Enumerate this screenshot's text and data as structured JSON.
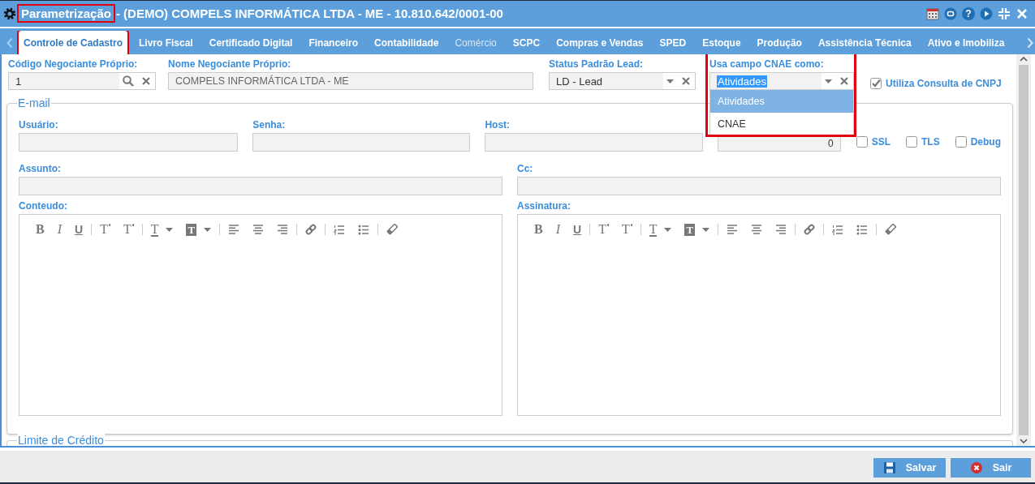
{
  "window": {
    "title": "Parametrização",
    "title_highlighted": true,
    "subtitle": "- (DEMO) COMPELS INFORMÁTICA LTDA - ME - 10.810.642/0001-00",
    "buttons": [
      {
        "kind": "calendar"
      },
      {
        "kind": "chat"
      },
      {
        "kind": "help",
        "glyph": "?"
      },
      {
        "kind": "play"
      },
      {
        "kind": "restore"
      },
      {
        "kind": "close"
      }
    ]
  },
  "tabs": [
    {
      "label": "Controle de Cadastro",
      "selected": true,
      "highlighted": true,
      "disabled": false
    },
    {
      "label": "Livro Fiscal",
      "selected": false,
      "highlighted": false,
      "disabled": false
    },
    {
      "label": "Certificado Digital",
      "selected": false,
      "highlighted": false,
      "disabled": false
    },
    {
      "label": "Financeiro",
      "selected": false,
      "highlighted": false,
      "disabled": false
    },
    {
      "label": "Contabilidade",
      "selected": false,
      "highlighted": false,
      "disabled": false
    },
    {
      "label": "Comércio",
      "selected": false,
      "highlighted": false,
      "disabled": true
    },
    {
      "label": "SCPC",
      "selected": false,
      "highlighted": false,
      "disabled": false
    },
    {
      "label": "Compras e Vendas",
      "selected": false,
      "highlighted": false,
      "disabled": false
    },
    {
      "label": "SPED",
      "selected": false,
      "highlighted": false,
      "disabled": false
    },
    {
      "label": "Estoque",
      "selected": false,
      "highlighted": false,
      "disabled": false
    },
    {
      "label": "Produção",
      "selected": false,
      "highlighted": false,
      "disabled": false
    },
    {
      "label": "Assistência Técnica",
      "selected": false,
      "highlighted": false,
      "disabled": false
    },
    {
      "label": "Ativo e Imobiliza",
      "selected": false,
      "highlighted": false,
      "disabled": false
    }
  ],
  "fields": [
    {
      "kind": "lookup",
      "label": "Código Negociante Próprio:",
      "value": "1"
    },
    {
      "kind": "text",
      "label": "Nome Negociante Próprio:",
      "value": "COMPELS INFORMÁTICA LTDA - ME"
    },
    {
      "kind": "select",
      "label": "Status Padrão Lead:",
      "value": "LD - Lead",
      "expanded": false,
      "highlighted": false
    },
    {
      "kind": "select",
      "label": "Usa campo CNAE como:",
      "value": "Atividades",
      "expanded": true,
      "highlighted": true,
      "options": [
        {
          "label": "Atividades",
          "selected": true
        },
        {
          "label": "CNAE",
          "selected": false
        }
      ]
    },
    {
      "kind": "checkbox",
      "label": "Utiliza Consulta de CNPJ",
      "checked": true
    }
  ],
  "email": {
    "legend": "E-mail",
    "row_1": [
      {
        "kind": "text",
        "label": "Usuário:"
      },
      {
        "kind": "text",
        "label": "Senha:"
      },
      {
        "kind": "text",
        "label": "Host:"
      },
      {
        "kind": "number",
        "value": "0"
      },
      {
        "kind": "checkbox",
        "label": "SSL",
        "checked": false
      },
      {
        "kind": "checkbox",
        "label": "TLS",
        "checked": false
      },
      {
        "kind": "checkbox",
        "label": "Debug",
        "checked": false
      }
    ],
    "row_2": [
      {
        "kind": "text",
        "label": "Assunto:"
      },
      {
        "kind": "text",
        "label": "Cc:"
      }
    ],
    "editors": [
      {
        "label": "Conteudo:",
        "toolbar": [
          {
            "kind": "bold",
            "glyph": "B"
          },
          {
            "kind": "italic",
            "glyph": "I"
          },
          {
            "kind": "underline",
            "glyph": "U"
          },
          {
            "kind": "separator"
          },
          {
            "kind": "superscript",
            "glyph": "T"
          },
          {
            "kind": "subscript",
            "glyph": "T"
          },
          {
            "kind": "separator"
          },
          {
            "kind": "text-color",
            "glyph": "T"
          },
          {
            "kind": "highlight",
            "glyph": "T"
          },
          {
            "kind": "separator"
          },
          {
            "kind": "align-left"
          },
          {
            "kind": "align-center"
          },
          {
            "kind": "align-right"
          },
          {
            "kind": "separator"
          },
          {
            "kind": "link"
          },
          {
            "kind": "separator"
          },
          {
            "kind": "ordered-list"
          },
          {
            "kind": "bullet-list"
          },
          {
            "kind": "separator"
          },
          {
            "kind": "eraser"
          }
        ]
      },
      {
        "label": "Assinatura:",
        "toolbar": [
          {
            "kind": "bold",
            "glyph": "B"
          },
          {
            "kind": "italic",
            "glyph": "I"
          },
          {
            "kind": "underline",
            "glyph": "U"
          },
          {
            "kind": "separator"
          },
          {
            "kind": "superscript",
            "glyph": "T"
          },
          {
            "kind": "subscript",
            "glyph": "T"
          },
          {
            "kind": "separator"
          },
          {
            "kind": "text-color",
            "glyph": "T"
          },
          {
            "kind": "highlight",
            "glyph": "T"
          },
          {
            "kind": "separator"
          },
          {
            "kind": "align-left"
          },
          {
            "kind": "align-center"
          },
          {
            "kind": "align-right"
          },
          {
            "kind": "separator"
          },
          {
            "kind": "link"
          },
          {
            "kind": "separator"
          },
          {
            "kind": "ordered-list"
          },
          {
            "kind": "bullet-list"
          },
          {
            "kind": "separator"
          },
          {
            "kind": "eraser"
          }
        ]
      }
    ]
  },
  "credit_limit": {
    "legend": "Limite de Crédito"
  },
  "footer": {
    "buttons": [
      {
        "kind": "save",
        "label": "Salvar"
      },
      {
        "kind": "exit",
        "label": "Sair"
      }
    ]
  }
}
